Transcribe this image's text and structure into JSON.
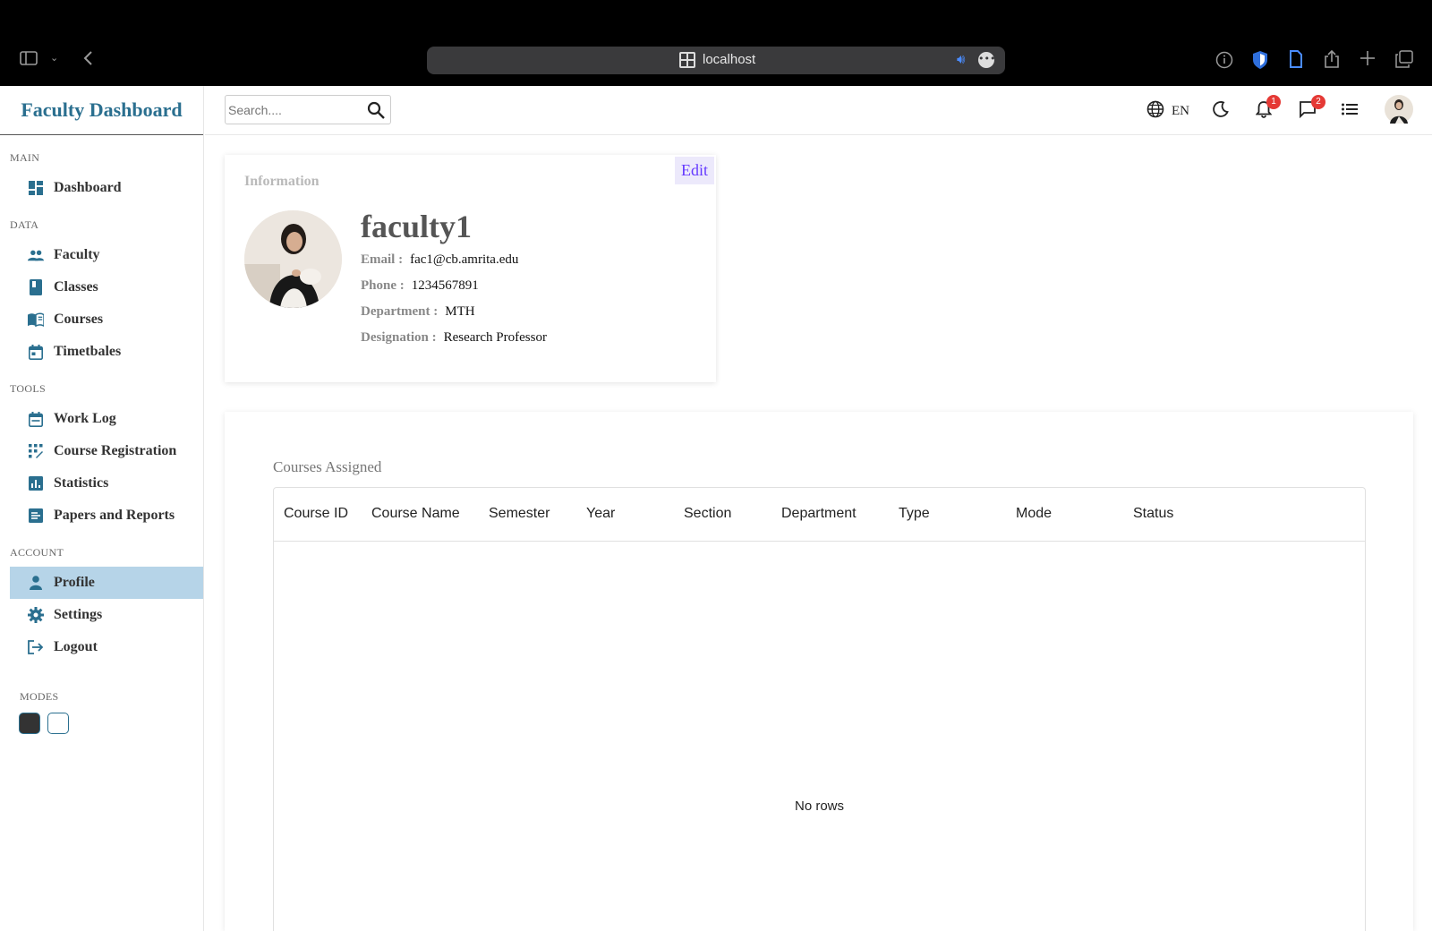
{
  "browser": {
    "url": "localhost"
  },
  "sidebar": {
    "brand": "Faculty Dashboard",
    "sections": [
      {
        "title": "MAIN",
        "items": [
          {
            "label": "Dashboard",
            "icon": "dashboard-icon"
          }
        ]
      },
      {
        "title": "DATA",
        "items": [
          {
            "label": "Faculty",
            "icon": "people-icon"
          },
          {
            "label": "Classes",
            "icon": "book-icon"
          },
          {
            "label": "Courses",
            "icon": "open-book-icon"
          },
          {
            "label": "Timetbales",
            "icon": "calendar-icon"
          }
        ]
      },
      {
        "title": "TOOLS",
        "items": [
          {
            "label": "Work Log",
            "icon": "calendar-icon"
          },
          {
            "label": "Course Registration",
            "icon": "app-registration-icon"
          },
          {
            "label": "Statistics",
            "icon": "chart-icon"
          },
          {
            "label": "Papers and Reports",
            "icon": "document-icon"
          }
        ]
      },
      {
        "title": "ACCOUNT",
        "items": [
          {
            "label": "Profile",
            "icon": "person-icon",
            "active": true
          },
          {
            "label": "Settings",
            "icon": "gear-icon"
          },
          {
            "label": "Logout",
            "icon": "logout-icon"
          }
        ]
      }
    ],
    "modes_title": "MODES",
    "modes": [
      {
        "name": "dark",
        "color": "#333333"
      },
      {
        "name": "light",
        "color": "#ffffff"
      }
    ]
  },
  "topbar": {
    "search_placeholder": "Search....",
    "language": "EN",
    "notifications_count": "1",
    "messages_count": "2"
  },
  "profile": {
    "section_title": "Information",
    "edit_label": "Edit",
    "name": "faculty1",
    "fields": [
      {
        "key": "Email :",
        "value": "fac1@cb.amrita.edu"
      },
      {
        "key": "Phone :",
        "value": "1234567891"
      },
      {
        "key": "Department :",
        "value": "MTH"
      },
      {
        "key": "Designation :",
        "value": "Research Professor"
      }
    ]
  },
  "courses": {
    "title": "Courses Assigned",
    "columns": [
      "Course ID",
      "Course Name",
      "Semester",
      "Year",
      "Section",
      "Department",
      "Type",
      "Mode",
      "Status"
    ],
    "empty_text": "No rows"
  },
  "colors": {
    "brand": "#2a6f8f",
    "active_nav": "#b6d4e8",
    "edit": "#6439ff",
    "badge": "#e53935"
  }
}
